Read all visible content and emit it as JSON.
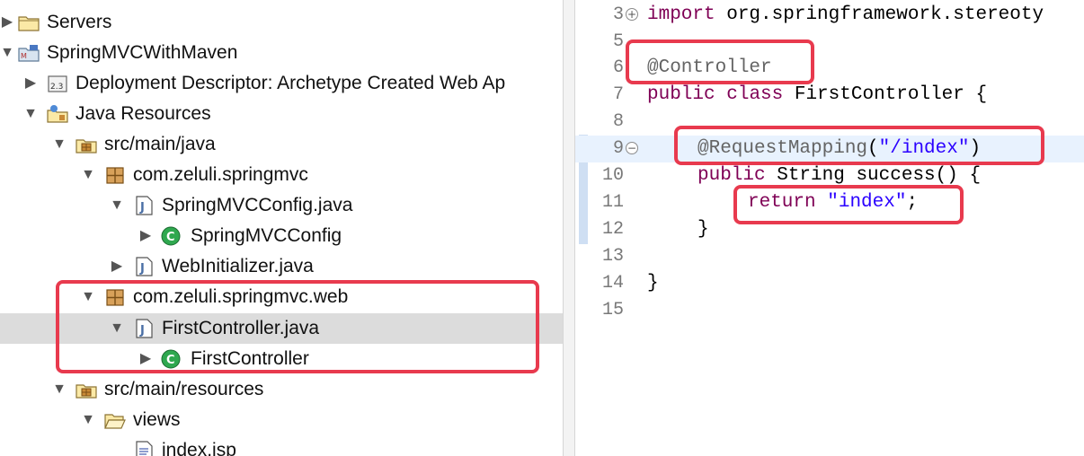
{
  "explorer": {
    "items": [
      {
        "label": "Servers"
      },
      {
        "label": "SpringMVCWithMaven"
      },
      {
        "label": "Deployment Descriptor: Archetype Created Web Ap"
      },
      {
        "label": "Java Resources"
      },
      {
        "label": "src/main/java"
      },
      {
        "label": "com.zeluli.springmvc"
      },
      {
        "label": "SpringMVCConfig.java"
      },
      {
        "label": "SpringMVCConfig"
      },
      {
        "label": "WebInitializer.java"
      },
      {
        "label": "com.zeluli.springmvc.web"
      },
      {
        "label": "FirstController.java"
      },
      {
        "label": "FirstController"
      },
      {
        "label": "src/main/resources"
      },
      {
        "label": "views"
      },
      {
        "label": "index.jsp"
      }
    ]
  },
  "editor": {
    "lines": [
      {
        "num": "3",
        "parts": [
          "import",
          " org.springframework.stereoty"
        ]
      },
      {
        "num": "5"
      },
      {
        "num": "6",
        "parts": [
          "@Controller"
        ]
      },
      {
        "num": "7",
        "parts": [
          "public",
          " ",
          "class",
          " FirstController {"
        ]
      },
      {
        "num": "8"
      },
      {
        "num": "9",
        "parts": [
          "@RequestMapping",
          "(",
          "\"/index\"",
          ")"
        ]
      },
      {
        "num": "10",
        "parts": [
          "public",
          " String success() {"
        ]
      },
      {
        "num": "11",
        "parts": [
          "return",
          " ",
          "\"index\"",
          ";"
        ]
      },
      {
        "num": "12",
        "parts": [
          "}"
        ]
      },
      {
        "num": "13"
      },
      {
        "num": "14",
        "parts": [
          "}"
        ]
      },
      {
        "num": "15"
      }
    ]
  },
  "colors": {
    "highlight_box": "#e83a4e",
    "keyword": "#7f0055",
    "string": "#2a00ff",
    "annotation": "#646464"
  }
}
